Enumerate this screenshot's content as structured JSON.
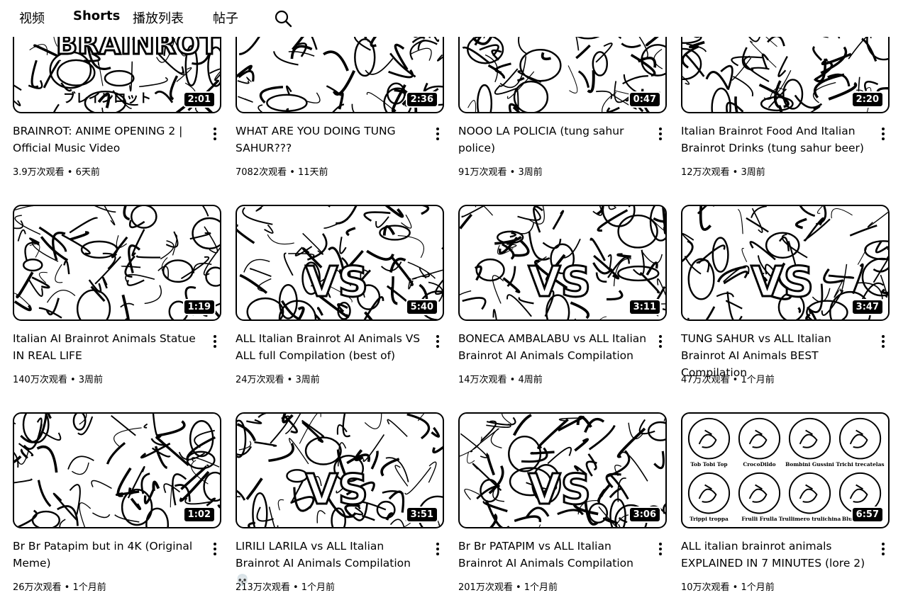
{
  "tabs": [
    "视频",
    "Shorts",
    "播放列表",
    "帖子"
  ],
  "videos": [
    {
      "title": "BRAINROT: ANIME OPENING 2 | Official Music Video",
      "duration": "2:01",
      "meta": "3.9万次观看 • 6天前",
      "overlay": "BRAINROT",
      "overlay_sub": "ブレインロット"
    },
    {
      "title": "WHAT ARE YOU DOING TUNG SAHUR???",
      "duration": "2:36",
      "meta": "7082次观看 • 11天前"
    },
    {
      "title": "NOOO LA POLICIA (tung sahur police)",
      "duration": "0:47",
      "meta": "91万次观看 • 3周前"
    },
    {
      "title": "Italian Brainrot Food And Italian Brainrot Drinks (tung sahur beer)",
      "duration": "2:20",
      "meta": "12万次观看 • 3周前"
    },
    {
      "title": "Italian AI Brainrot Animals Statue IN REAL LIFE",
      "duration": "1:19",
      "meta": "140万次观看 • 3周前"
    },
    {
      "title": "ALL Italian Brainrot AI Animals VS ALL full Compilation (best of)",
      "duration": "5:40",
      "meta": "24万次观看 • 3周前",
      "overlay": "VS"
    },
    {
      "title": "BONECA AMBALABU vs ALL Italian Brainrot AI Animals Compilation",
      "duration": "3:11",
      "meta": "14万次观看 • 4周前",
      "overlay": "VS"
    },
    {
      "title": "TUNG SAHUR vs ALL Italian Brainrot AI Animals BEST Compilation",
      "duration": "3:47",
      "meta": "47万次观看 • 1个月前",
      "overlay": "VS"
    },
    {
      "title": "Br Br Patapim but in 4K (Original Meme)",
      "duration": "1:02",
      "meta": "26万次观看 • 1个月前"
    },
    {
      "title": "LIRILI LARILA vs ALL Italian Brainrot AI Animals Compilation 💀",
      "duration": "3:51",
      "meta": "213万次观看 • 1个月前",
      "overlay": "VS"
    },
    {
      "title": "Br Br PATAPIM vs ALL Italian Brainrot AI Animals Compilation",
      "duration": "3:06",
      "meta": "201万次观看 • 1个月前",
      "overlay": "VS"
    },
    {
      "title": "ALL italian brainrot animals EXPLAINED IN 7 MINUTES (lore 2)",
      "duration": "6:57",
      "meta": "10万次观看 • 1个月前",
      "circles": [
        "Tob Tobi Top",
        "CrocoDildo",
        "Bombini Gussini",
        "Trichi trecatelas",
        "Trippi troppa",
        "Frulli Frulla",
        "Trullimero trulichina",
        "Blue tobiere"
      ]
    }
  ]
}
